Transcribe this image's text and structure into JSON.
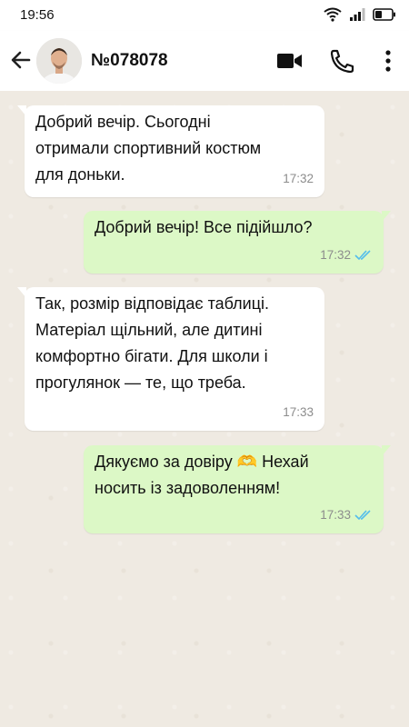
{
  "status_bar": {
    "time": "19:56",
    "icons": [
      "wifi-icon",
      "signal-icon",
      "battery-icon"
    ]
  },
  "header": {
    "contact_name": "№078078",
    "icons": [
      "back-arrow-icon",
      "avatar",
      "video-call-icon",
      "phone-icon",
      "more-vert-icon"
    ]
  },
  "messages": [
    {
      "direction": "incoming",
      "text": " Добрий вечір. Сьогодні\nотримали спортивний костюм\nдля доньки.",
      "time": "17:32"
    },
    {
      "direction": "outgoing",
      "text": "Добрий вечір! Все підійшло?",
      "time": "17:32",
      "status": "read"
    },
    {
      "direction": "incoming",
      "text": " Так, розмір відповідає таблиці.\nМатеріал щільний, але дитині\nкомфортно бігати. Для школи і\nпрогулянок — те, що треба.",
      "time": "17:33"
    },
    {
      "direction": "outgoing",
      "text": "Дякуємо за довіру 🫶 Нехай\nносить із задоволенням!",
      "time": "17:33",
      "status": "read"
    }
  ],
  "colors": {
    "chat_background": "#efeae2",
    "incoming_bubble": "#ffffff",
    "outgoing_bubble": "#dcf8c6",
    "read_ticks": "#53bdeb",
    "timestamp": "#8c8c8c"
  }
}
